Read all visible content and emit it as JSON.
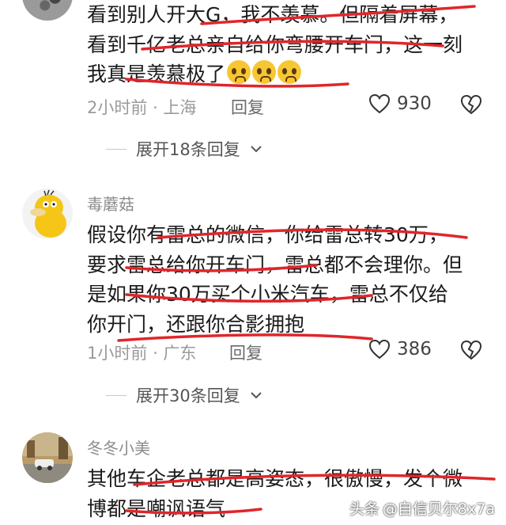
{
  "comments": [
    {
      "username": "",
      "lines": [
        "看到别人开大G，我不羡慕。但隔着屏幕，",
        "看到千亿老总亲自给你弯腰开车门，这一刻",
        "我真是羡慕极了"
      ],
      "emoji_count": 3,
      "emoji_name": "pleading-face-emoji",
      "time": "2小时前",
      "location": "上海",
      "reply_label": "回复",
      "likes": "930",
      "expand_label": "展开18条回复"
    },
    {
      "username": "毒蘑菇",
      "lines": [
        "假设你有雷总的微信，你给雷总转30万，",
        "要求雷总给你开车门，雷总都不会理你。但",
        "是如果你30万买个小米汽车，雷总不仅给",
        "你开门，还跟你合影拥抱"
      ],
      "time": "1小时前",
      "location": "广东",
      "reply_label": "回复",
      "likes": "386",
      "expand_label": "展开30条回复"
    },
    {
      "username": "冬冬小美",
      "lines": [
        "其他车企老总都是高姿态，很傲慢，发个微",
        "博都是嘲讽语气"
      ]
    }
  ],
  "watermark": {
    "platform": "头条",
    "account": "@自信贝尔8x7a"
  },
  "icons": {
    "like": "heart-outline-icon",
    "dislike": "broken-heart-icon",
    "expand": "chevron-down-icon"
  },
  "colors": {
    "annotation": "#e0262b",
    "meta_text": "#9a9a9a",
    "username": "#8c8c8c"
  }
}
